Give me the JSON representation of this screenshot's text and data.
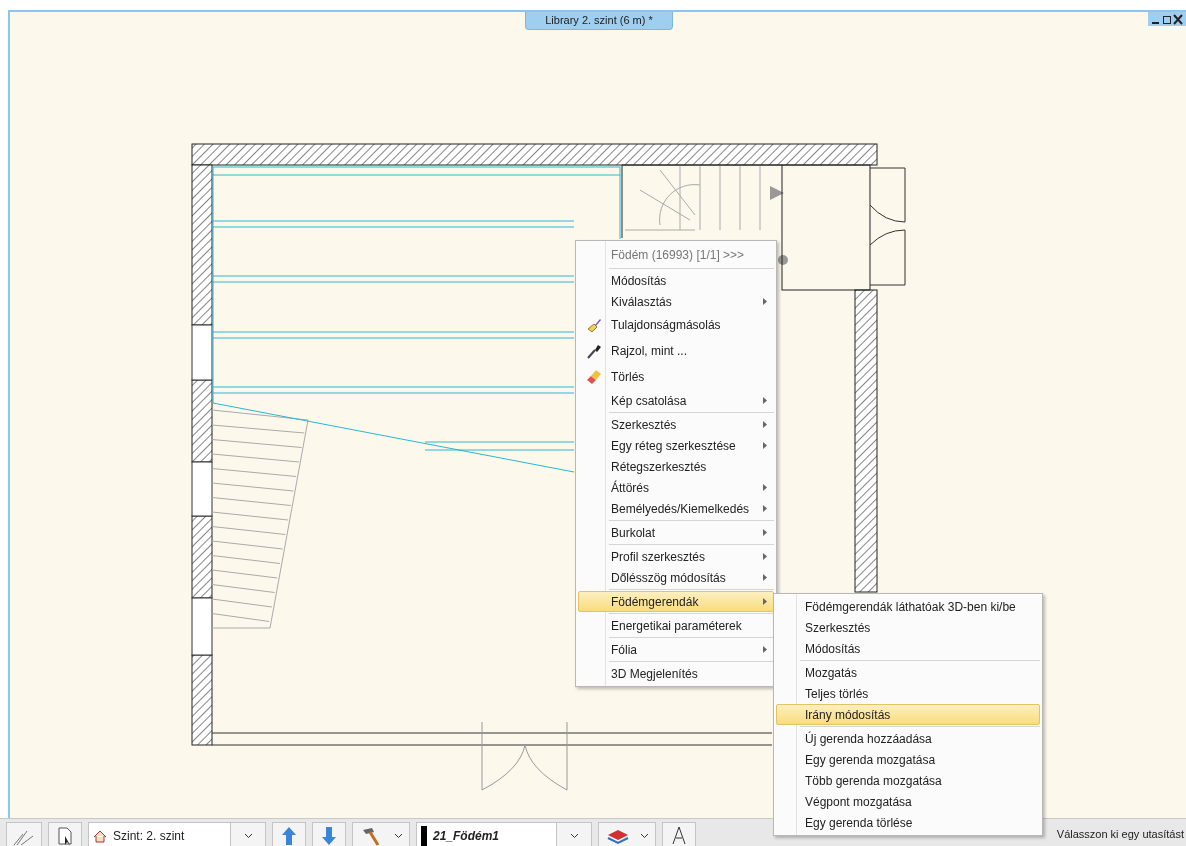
{
  "window": {
    "title": "Library 2. szint (6 m) *"
  },
  "context_menu": {
    "header": "Födém (16993) [1/1] >>>",
    "sections": [
      [
        {
          "label": "Módosítás",
          "submenu": false,
          "selected": false
        },
        {
          "label": "Kiválasztás",
          "submenu": true,
          "selected": false
        },
        {
          "label": "Tulajdonságmásolás",
          "kind": "icon",
          "submenu": false,
          "selected": false
        },
        {
          "label": "Rajzol, mint ...",
          "kind": "icon",
          "submenu": false,
          "selected": false
        },
        {
          "label": "Törlés",
          "kind": "icon",
          "submenu": false,
          "selected": false
        },
        {
          "label": "Kép csatolása",
          "submenu": true,
          "selected": false
        }
      ],
      [
        {
          "label": "Szerkesztés",
          "submenu": true,
          "selected": false
        },
        {
          "label": "Egy réteg szerkesztése",
          "submenu": true,
          "selected": false
        },
        {
          "label": "Rétegszerkesztés",
          "submenu": false,
          "selected": false
        },
        {
          "label": "Áttörés",
          "submenu": true,
          "selected": false
        },
        {
          "label": "Bemélyedés/Kiemelkedés",
          "submenu": true,
          "selected": false
        }
      ],
      [
        {
          "label": "Burkolat",
          "submenu": true,
          "selected": false
        }
      ],
      [
        {
          "label": "Profil szerkesztés",
          "submenu": true,
          "selected": false
        },
        {
          "label": "Dőlésszög módosítás",
          "submenu": true,
          "selected": false
        }
      ],
      [
        {
          "label": "Födémgerendák",
          "submenu": true,
          "selected": true
        }
      ],
      [
        {
          "label": "Energetikai paraméterek",
          "submenu": false,
          "selected": false
        }
      ],
      [
        {
          "label": "Fólia",
          "submenu": true,
          "selected": false
        }
      ],
      [
        {
          "label": "3D Megjelenítés",
          "submenu": false,
          "selected": false
        }
      ]
    ]
  },
  "submenu": {
    "sections": [
      [
        {
          "label": "Födémgerendák láthatóak 3D-ben ki/be",
          "selected": false
        },
        {
          "label": "Szerkesztés",
          "selected": false
        },
        {
          "label": "Módosítás",
          "selected": false
        }
      ],
      [
        {
          "label": "Mozgatás",
          "selected": false
        },
        {
          "label": "Teljes törlés",
          "selected": false
        },
        {
          "label": "Irány módosítás",
          "selected": true
        }
      ],
      [
        {
          "label": "Új gerenda hozzáadása",
          "selected": false
        },
        {
          "label": "Egy gerenda mozgatása",
          "selected": false
        },
        {
          "label": "Több gerenda mozgatása",
          "selected": false
        },
        {
          "label": "Végpont mozgatása",
          "selected": false
        },
        {
          "label": "Egy gerenda törlése",
          "selected": false
        }
      ]
    ]
  },
  "toolbar": {
    "level_combo": "Szint: 2. szint",
    "layer_combo": "21_Födém1"
  },
  "status_bar": {
    "text": "Válasszon ki egy utasítást"
  }
}
